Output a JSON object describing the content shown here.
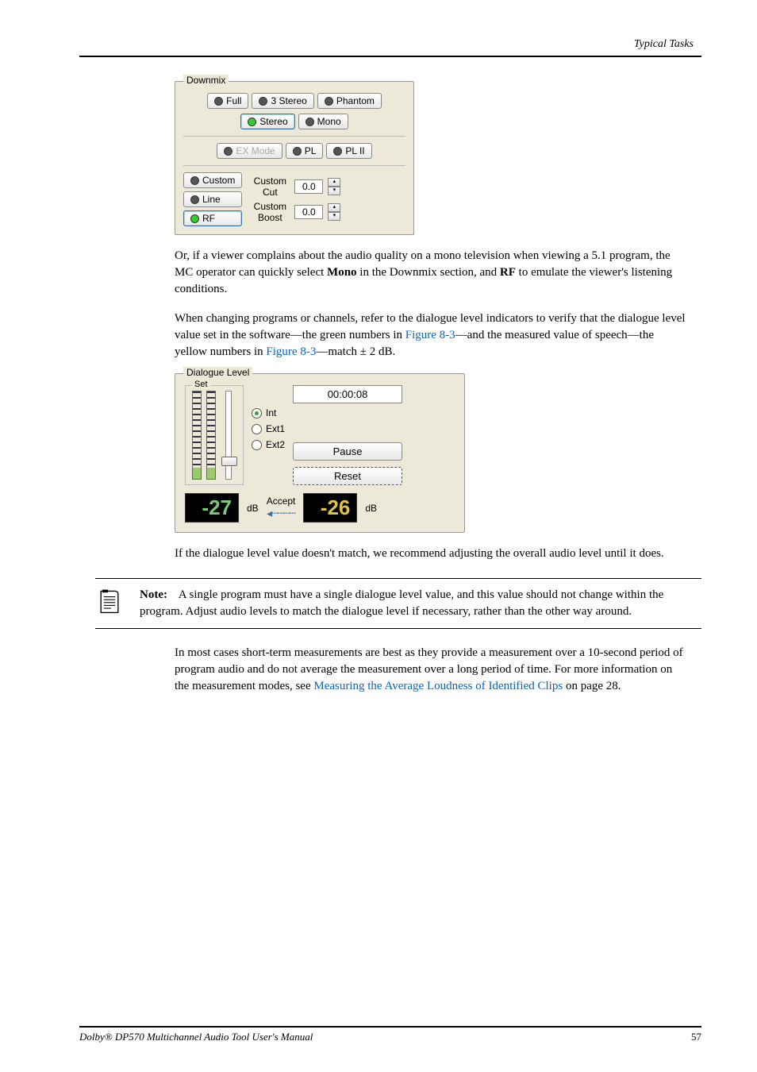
{
  "header": {
    "title": "Typical Tasks"
  },
  "downmix": {
    "title": "Downmix",
    "row1": [
      "Full",
      "3 Stereo",
      "Phantom"
    ],
    "row2": [
      "Stereo",
      "Mono"
    ],
    "row3": [
      "EX Mode",
      "PL",
      "PL II"
    ],
    "leftButtons": [
      "Custom",
      "Line",
      "RF"
    ],
    "cutLabel": "Custom\nCut",
    "boostLabel": "Custom\nBoost",
    "cutValue": "0.0",
    "boostValue": "0.0"
  },
  "para1_a": "Or, if a viewer complains about the audio quality on a mono television when viewing a 5.1 program, the MC operator can quickly select ",
  "para1_bold1": "Mono",
  "para1_b": " in the Downmix section, and ",
  "para1_bold2": "RF",
  "para1_c": " to emulate the viewer's listening conditions.",
  "para2_a": "When changing programs or channels, refer to the dialogue level indicators to verify that the dialogue level value set in the software—the green numbers in ",
  "para2_link1": "Figure 8-3",
  "para2_b": "—and the measured value of speech—the yellow numbers in ",
  "para2_link2": "Figure 8-3",
  "para2_c": "—match ± 2 dB.",
  "dialogue": {
    "title": "Dialogue Level",
    "setLabel": "Set",
    "radios": [
      "Int",
      "Ext1",
      "Ext2"
    ],
    "time": "00:00:08",
    "pause": "Pause",
    "reset": "Reset",
    "accept": "Accept",
    "leftValue": "-27",
    "rightValue": "-26",
    "db": "dB"
  },
  "para3": "If the dialogue level value doesn't match, we recommend adjusting the overall audio level until it does.",
  "note": {
    "label": "Note:",
    "text": "A single program must have a single dialogue level value, and this value should not change within the program. Adjust audio levels to match the dialogue level if necessary, rather than the other way around."
  },
  "para4_a": "In most cases short-term measurements are best as they provide a measurement over a 10-second period of program audio and do not average the measurement over a long period of time. For more information on the measurement modes, see ",
  "para4_link": "Measuring the Average Loudness of Identified Clips",
  "para4_b": " on page 28.",
  "footer": {
    "left": "Dolby® DP570 Multichannel Audio Tool User's Manual",
    "right": "57"
  }
}
